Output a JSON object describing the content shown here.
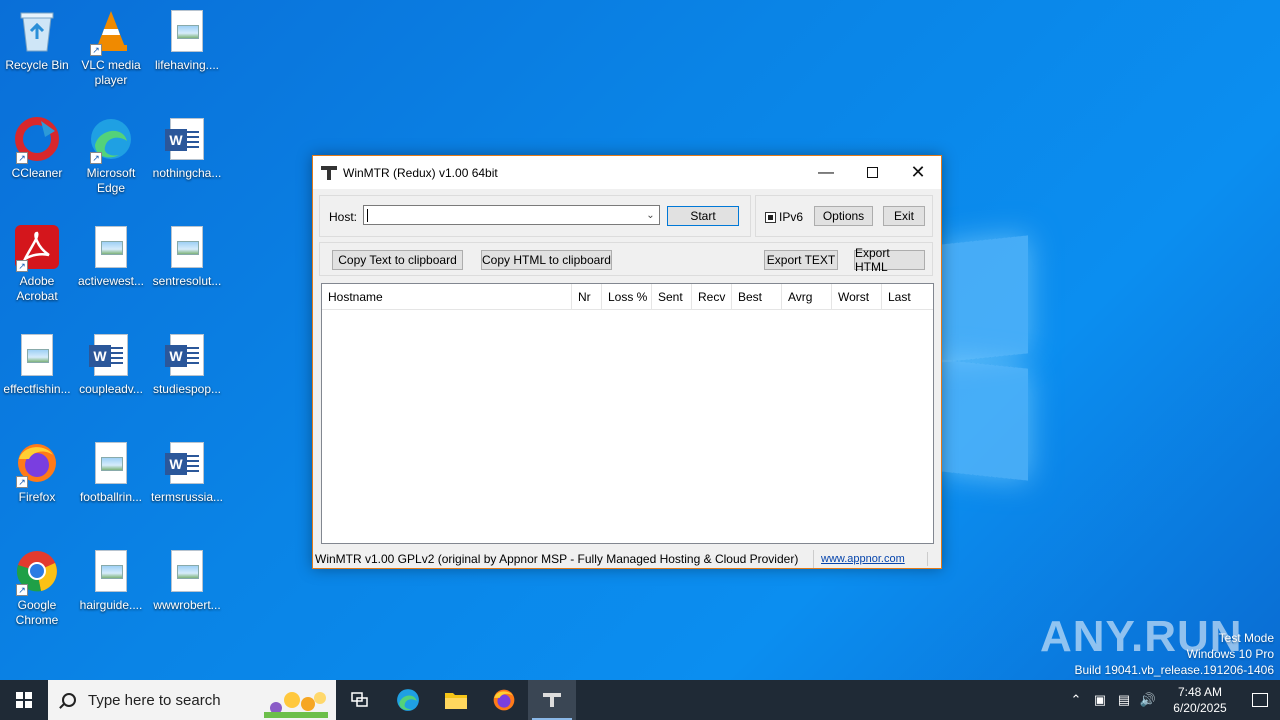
{
  "desktop": {
    "icons": [
      {
        "label": "Recycle Bin"
      },
      {
        "label": "VLC media player"
      },
      {
        "label": "lifehaving...."
      },
      {
        "label": "CCleaner"
      },
      {
        "label": "Microsoft Edge"
      },
      {
        "label": "nothingcha..."
      },
      {
        "label": "Adobe Acrobat"
      },
      {
        "label": "activewest..."
      },
      {
        "label": "sentresolut..."
      },
      {
        "label": "effectfishin..."
      },
      {
        "label": "coupleadv..."
      },
      {
        "label": "studiespop..."
      },
      {
        "label": "Firefox"
      },
      {
        "label": "footballrin..."
      },
      {
        "label": "termsrussia..."
      },
      {
        "label": "Google Chrome"
      },
      {
        "label": "hairguide...."
      },
      {
        "label": "wwwrobert..."
      }
    ]
  },
  "window": {
    "title": "WinMTR (Redux) v1.00 64bit",
    "host_label": "Host:",
    "host_value": "",
    "start_label": "Start",
    "ipv6_label": "IPv6",
    "ipv6_checked": true,
    "options_label": "Options",
    "exit_label": "Exit",
    "copy_text_label": "Copy Text to clipboard",
    "copy_html_label": "Copy HTML to clipboard",
    "export_text_label": "Export TEXT",
    "export_html_label": "Export HTML",
    "columns": [
      "Hostname",
      "Nr",
      "Loss %",
      "Sent",
      "Recv",
      "Best",
      "Avrg",
      "Worst",
      "Last"
    ],
    "status_text": "WinMTR v1.00 GPLv2 (original by Appnor MSP - Fully Managed Hosting & Cloud Provider)",
    "status_link": "www.appnor.com"
  },
  "taskbar": {
    "search_placeholder": "Type here to search",
    "time": "7:48 AM",
    "date": "6/20/2025"
  },
  "watermark": {
    "line1": "Test Mode",
    "line2": "Windows 10 Pro",
    "line3": "Build 19041.vb_release.191206-1406",
    "brand": "ANY.RUN"
  }
}
